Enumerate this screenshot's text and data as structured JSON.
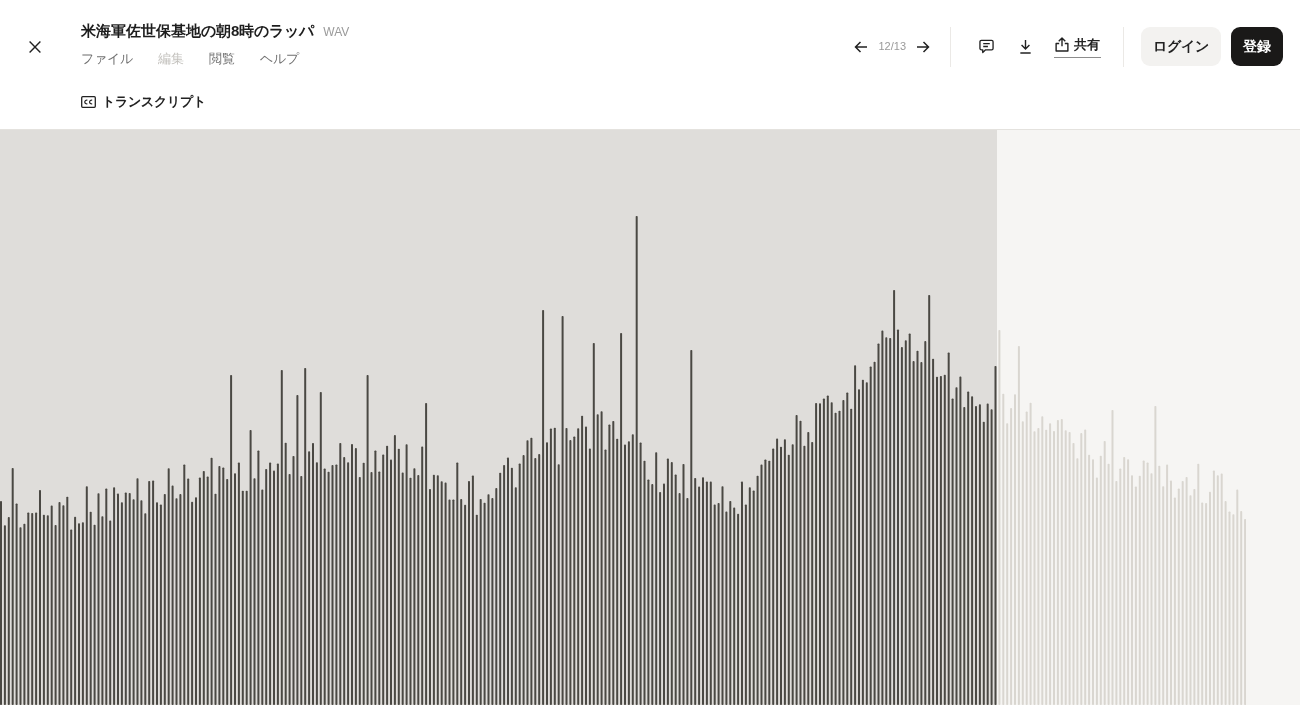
{
  "window": {
    "title": "米海軍佐世保基地の朝8時のラッパ",
    "file_type": "WAV"
  },
  "menu": [
    {
      "label": "ファイル",
      "disabled": false
    },
    {
      "label": "編集",
      "disabled": true
    },
    {
      "label": "閲覧",
      "disabled": false
    },
    {
      "label": "ヘルプ",
      "disabled": false
    }
  ],
  "transcript_button": {
    "label": "トランスクリプト"
  },
  "pager": {
    "position": "12/13"
  },
  "share_button": {
    "label": "共有",
    "focused": true
  },
  "account": {
    "login": "ログイン",
    "signup": "登録"
  },
  "player": {
    "level": 0.767
  }
}
